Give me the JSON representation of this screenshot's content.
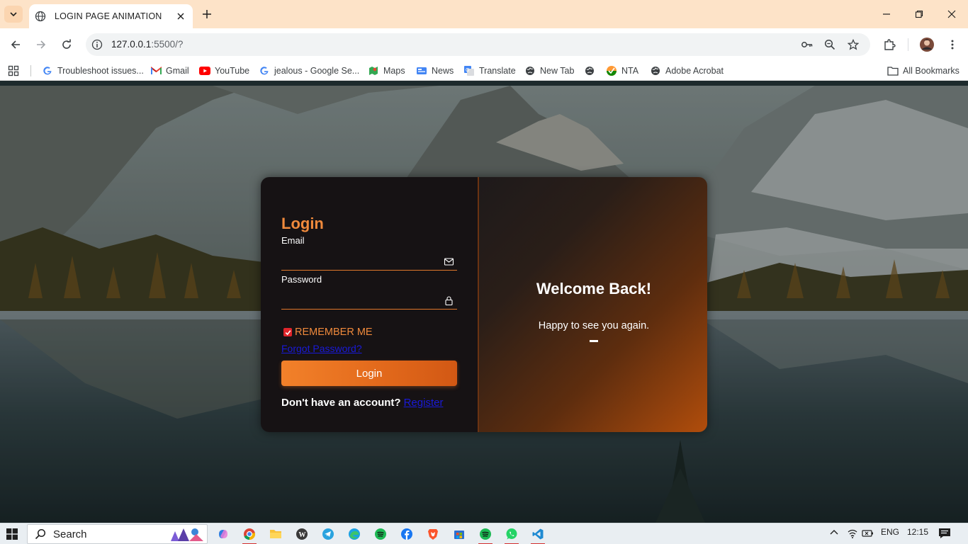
{
  "tab": {
    "title": "LOGIN PAGE ANIMATION"
  },
  "address": {
    "host": "127.0.0.1",
    "rest": ":5500/?"
  },
  "bookmarks": [
    {
      "label": "Troubleshoot issues..."
    },
    {
      "label": "Gmail"
    },
    {
      "label": "YouTube"
    },
    {
      "label": "jealous - Google Se..."
    },
    {
      "label": "Maps"
    },
    {
      "label": "News"
    },
    {
      "label": "Translate"
    },
    {
      "label": "New Tab"
    },
    {
      "label": ""
    },
    {
      "label": "NTA"
    },
    {
      "label": "Adobe Acrobat"
    }
  ],
  "all_bookmarks": "All Bookmarks",
  "login": {
    "title": "Login",
    "email_label": "Email",
    "password_label": "Password",
    "remember_label": "REMEMBER ME",
    "remember_checked": true,
    "forgot_link": "Forgot Password?",
    "button_label": "Login",
    "signup_text": "Don't have an account?",
    "signup_link": "Register"
  },
  "welcome": {
    "heading": "Welcome Back!",
    "subtext": "Happy to see you again."
  },
  "taskbar": {
    "search_label": "Search",
    "language": "ENG",
    "time": "12:15"
  },
  "colors": {
    "accent": "#f08a3c",
    "button_start": "#f2812a",
    "button_end": "#d25814",
    "card_dark": "#161214",
    "link": "#1a1ad9"
  }
}
